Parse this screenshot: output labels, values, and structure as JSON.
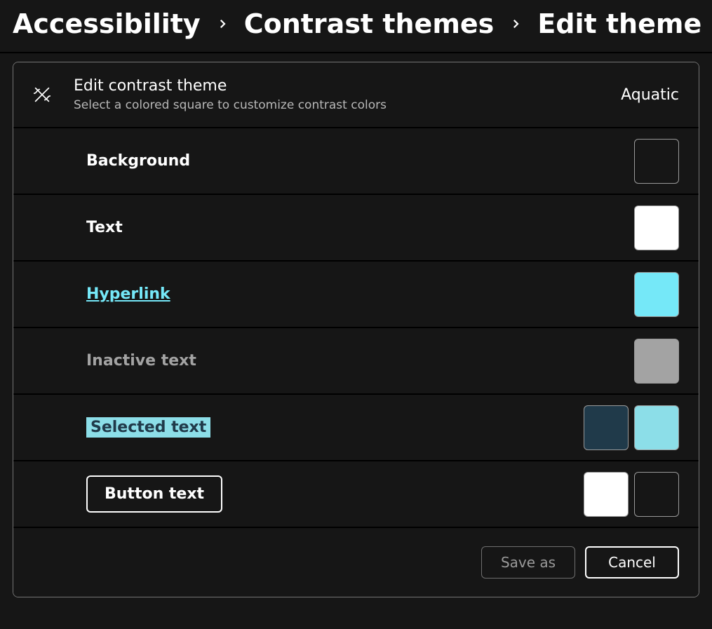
{
  "breadcrumb": {
    "item0": "Accessibility",
    "item1": "Contrast themes",
    "item2": "Edit theme"
  },
  "panel": {
    "title": "Edit contrast theme",
    "subtitle": "Select a colored square to customize contrast colors",
    "theme_name": "Aquatic"
  },
  "rows": {
    "background": {
      "label": "Background",
      "swatch1": "#161616"
    },
    "text": {
      "label": "Text",
      "swatch1": "#ffffff"
    },
    "hyperlink": {
      "label": "Hyperlink",
      "swatch1": "#75e8f8"
    },
    "inactive": {
      "label": "Inactive text",
      "swatch1": "#a3a3a3"
    },
    "selected": {
      "label": "Selected text",
      "swatch1": "#203a4a",
      "swatch2": "#8cdee8"
    },
    "button": {
      "label": "Button text",
      "swatch1": "#ffffff",
      "swatch2": "#161616"
    }
  },
  "actions": {
    "save_as": "Save as",
    "cancel": "Cancel"
  }
}
